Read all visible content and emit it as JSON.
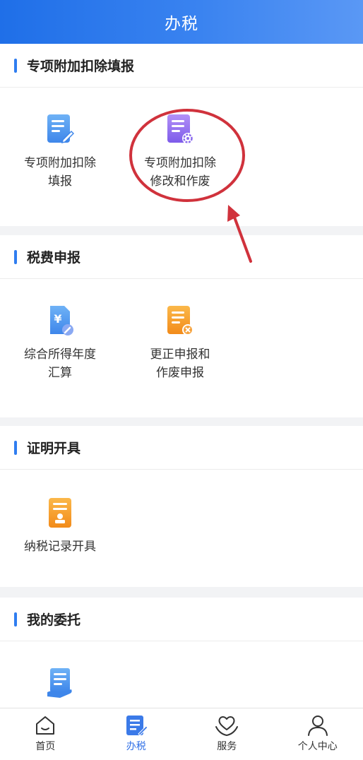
{
  "header": {
    "title": "办税"
  },
  "sections": [
    {
      "title": "专项附加扣除填报",
      "items": [
        {
          "line1": "专项附加扣除",
          "line2": "填报",
          "icon": "doc-edit-icon"
        },
        {
          "line1": "专项附加扣除",
          "line2": "修改和作废",
          "icon": "doc-settings-icon"
        }
      ]
    },
    {
      "title": "税费申报",
      "items": [
        {
          "line1": "综合所得年度",
          "line2": "汇算",
          "icon": "yuan-doc-icon"
        },
        {
          "line1": "更正申报和",
          "line2": "作废申报",
          "icon": "doc-cancel-icon"
        }
      ]
    },
    {
      "title": "证明开具",
      "items": [
        {
          "line1": "纳税记录开具",
          "line2": "",
          "icon": "doc-stamp-icon"
        }
      ]
    },
    {
      "title": "我的委托",
      "items": [
        {
          "line1": "",
          "line2": "",
          "icon": "doc-hand-icon"
        }
      ]
    }
  ],
  "tabs": [
    {
      "label": "首页",
      "icon": "home-icon",
      "active": false
    },
    {
      "label": "办税",
      "icon": "tax-doc-icon",
      "active": true
    },
    {
      "label": "服务",
      "icon": "heart-hands-icon",
      "active": false
    },
    {
      "label": "个人中心",
      "icon": "person-icon",
      "active": false
    }
  ],
  "colors": {
    "brand": "#2f7df0",
    "annotation": "#d0323c"
  }
}
